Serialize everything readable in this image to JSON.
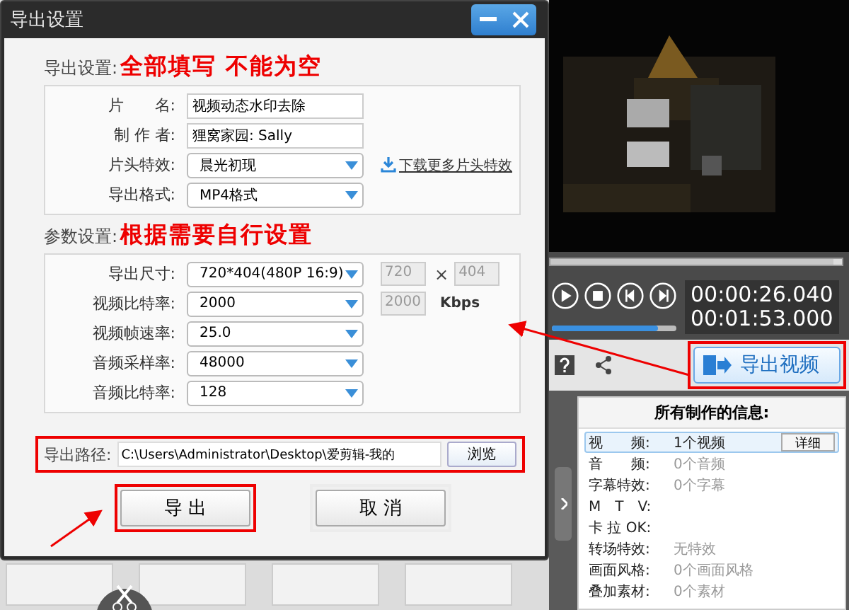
{
  "dialog": {
    "title": "导出设置",
    "sections": [
      {
        "label": "导出设置:",
        "note": "全部填写 不能为空",
        "fields": [
          {
            "kind": "text",
            "label": "片　　名:",
            "value": "视频动态水印去除"
          },
          {
            "kind": "text",
            "label": "制 作 者:",
            "value": "狸窝家园: Sally"
          },
          {
            "kind": "select",
            "label": "片头特效:",
            "value": "晨光初现",
            "link": "下载更多片头特效"
          },
          {
            "kind": "select",
            "label": "导出格式:",
            "value": "MP4格式"
          }
        ]
      },
      {
        "label": "参数设置:",
        "note": "根据需要自行设置",
        "fields": [
          {
            "kind": "select",
            "label": "导出尺寸:",
            "value": "720*404(480P 16:9)",
            "extra": [
              "720",
              "404"
            ],
            "separator": "×"
          },
          {
            "kind": "select",
            "label": "视频比特率:",
            "value": "2000",
            "extra": [
              "2000"
            ],
            "unit": "Kbps"
          },
          {
            "kind": "select",
            "label": "视频帧速率:",
            "value": "25.0"
          },
          {
            "kind": "select",
            "label": "音频采样率:",
            "value": "48000"
          },
          {
            "kind": "select",
            "label": "音频比特率:",
            "value": "128"
          }
        ]
      }
    ],
    "path": {
      "label": "导出路径:",
      "value": "C:\\Users\\Administrator\\Desktop\\爱剪辑-我的",
      "button": "浏览"
    },
    "buttons": [
      {
        "label": "导 出",
        "highlighted": true
      },
      {
        "label": "取 消",
        "highlighted": false
      }
    ]
  },
  "player": {
    "progress": {
      "level": 0.97
    },
    "volume": {
      "level": 0.85
    },
    "times": [
      "00:00:26.040",
      "00:01:53.000"
    ],
    "export_button": "导出视频"
  },
  "info": {
    "title": "所有制作的信息:",
    "rows": [
      {
        "label": "视　　频:",
        "value": "1个视频",
        "selected": true,
        "button": "详细"
      },
      {
        "label": "音　　频:",
        "value": "0个音频",
        "selected": false
      },
      {
        "label": "字幕特效:",
        "value": "0个字幕",
        "selected": false
      },
      {
        "label": "M　T　V:",
        "selected": false
      },
      {
        "label": "卡 拉 OK:",
        "selected": false
      },
      {
        "label": "转场特效:",
        "value": "无特效",
        "selected": false
      },
      {
        "label": "画面风格:",
        "value": "0个画面风格",
        "selected": false
      },
      {
        "label": "叠加素材:",
        "value": "0个素材",
        "selected": false
      }
    ]
  }
}
